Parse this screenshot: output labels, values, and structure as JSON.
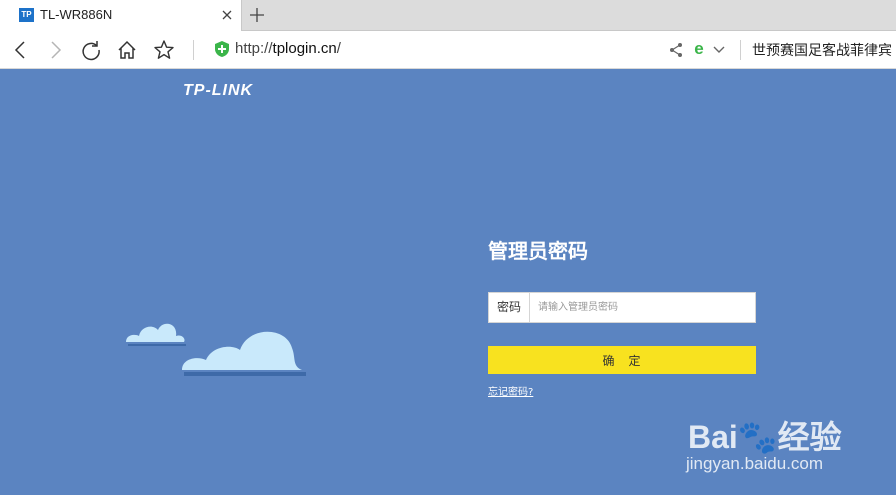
{
  "browser": {
    "tab": {
      "favicon_text": "TP",
      "title": "TL-WR886N"
    },
    "url": {
      "scheme": "http://",
      "host": "tplogin.cn",
      "path": "/"
    },
    "news_ticker": "世预赛国足客战菲律宾",
    "icons": [
      "back-icon",
      "forward-icon",
      "refresh-icon",
      "home-icon",
      "star-icon",
      "shield-icon",
      "share-icon",
      "edge-icon",
      "chevron-down-icon",
      "close-icon",
      "plus-icon"
    ],
    "colors": {
      "tab_favicon": "#1d72c9",
      "shield": "#3bb54a"
    }
  },
  "page": {
    "logo": "TP-LINK",
    "title": "管理员密码",
    "password": {
      "label": "密码",
      "placeholder": "请输入管理员密码",
      "value": ""
    },
    "confirm_label": "确　定",
    "forgot_link": "忘记密码?",
    "colors": {
      "background": "#5b84c1",
      "button": "#f8e21f",
      "cloud": "#c9e9fb"
    }
  },
  "watermark": {
    "brand": "Bai🐾经验",
    "url": "jingyan.baidu.com"
  }
}
